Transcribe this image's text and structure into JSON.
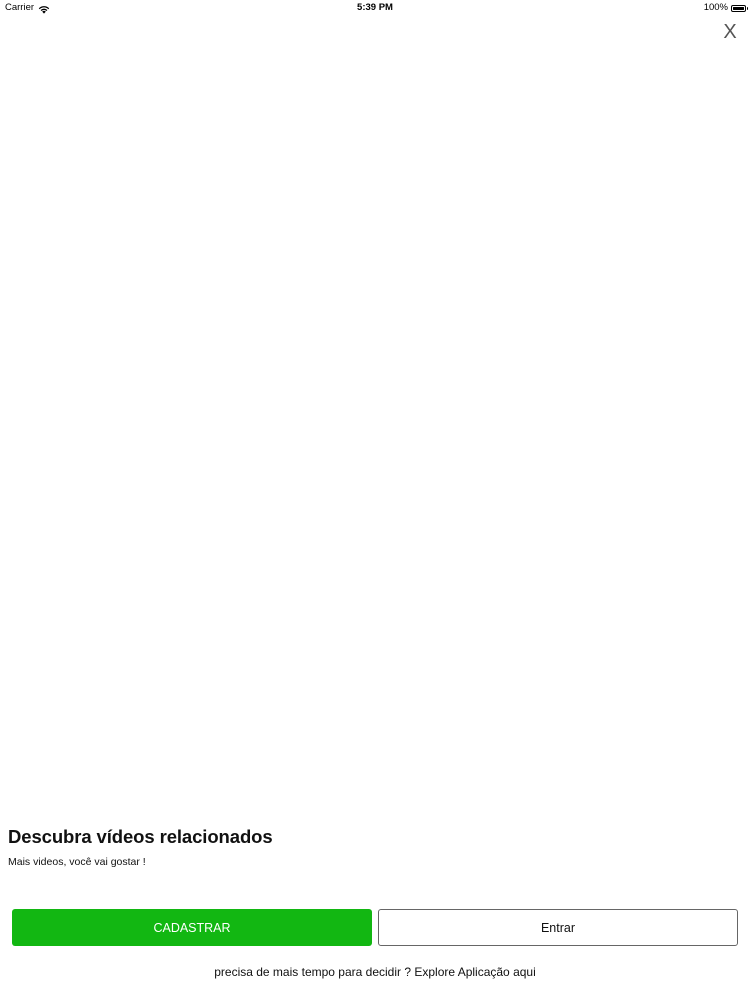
{
  "status_bar": {
    "carrier": "Carrier",
    "time": "5:39 PM",
    "battery": "100%",
    "battery_level": 1.0,
    "icons": [
      "wifi-icon",
      "battery-icon"
    ]
  },
  "close": {
    "label": "X"
  },
  "content": {
    "title": "Descubra vídeos relacionados",
    "subtitle": "Mais videos, você vai gostar !"
  },
  "actions": {
    "signup_label": "CADASTRAR",
    "login_label": "Entrar"
  },
  "footer": {
    "prompt": "precisa de mais tempo para decidir ?",
    "link": "Explore Aplicação aqui"
  },
  "colors": {
    "primary": "#12b712",
    "background": "#ffffff",
    "text": "#111111",
    "border": "#666666"
  }
}
